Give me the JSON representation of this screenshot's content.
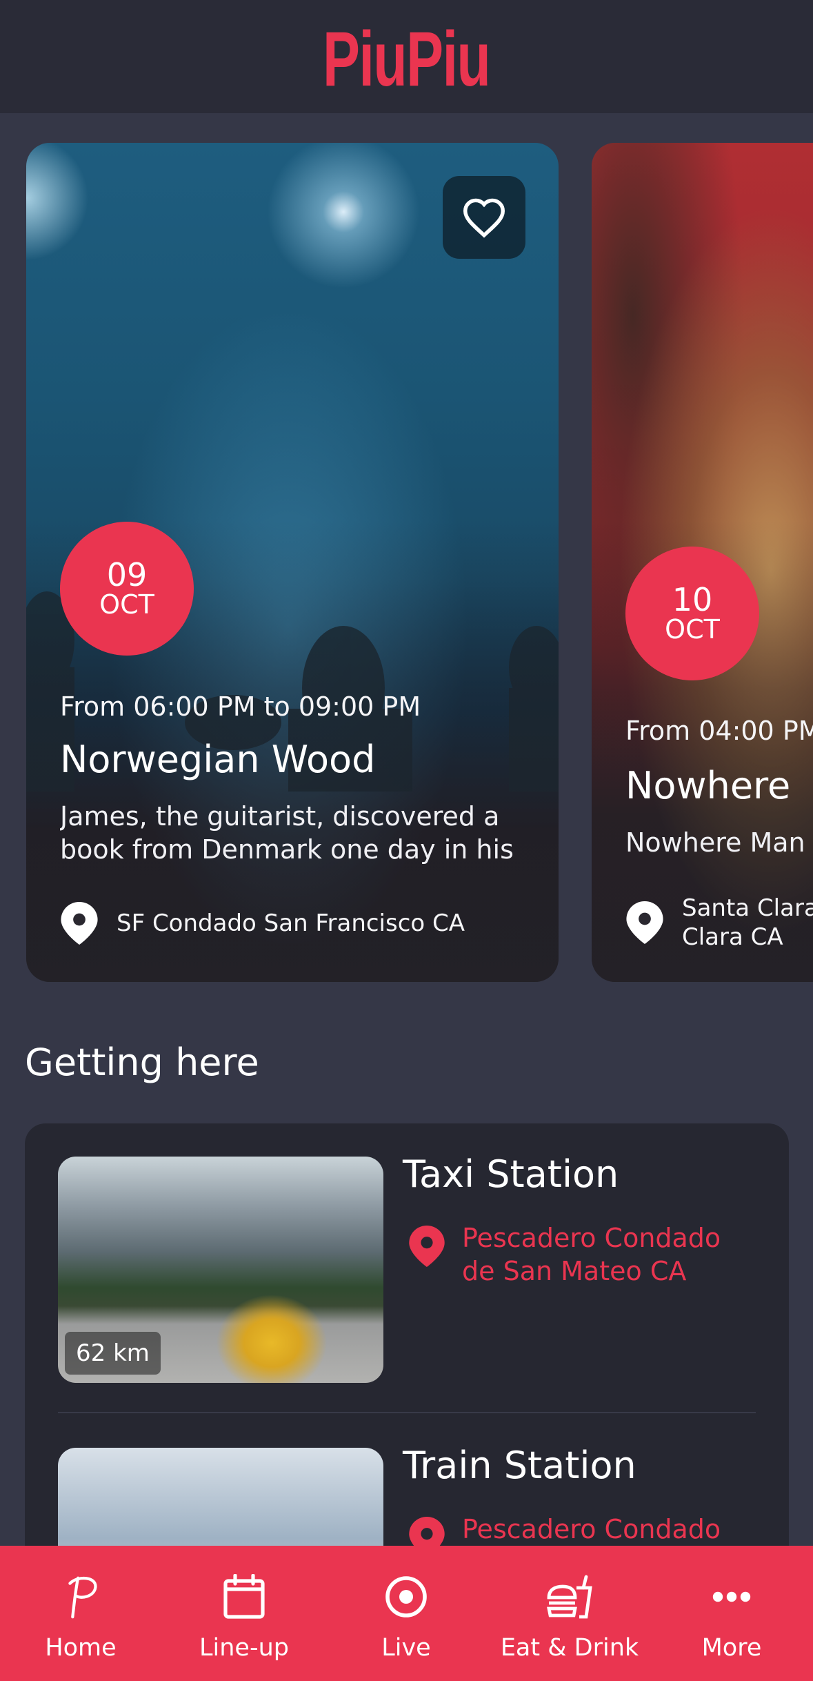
{
  "app": {
    "logo": "PiuPiu",
    "brand_color": "#ea3550",
    "background": "#353747"
  },
  "events": [
    {
      "day": "09",
      "month": "OCT",
      "time": "From 06:00 PM to 09:00 PM",
      "title": "Norwegian Wood",
      "description": "James, the guitarist, discovered a book from Denmark one day in his",
      "location": "SF Condado San Francisco CA",
      "favorite_icon": "heart-outline-icon"
    },
    {
      "day": "10",
      "month": "OCT",
      "time": "From 04:00 PM",
      "title": "Nowhere",
      "description": "Nowhere Man",
      "location": "Santa Clara\nClara CA"
    }
  ],
  "getting_here": {
    "title": "Getting here",
    "items": [
      {
        "title": "Taxi Station",
        "distance": "62 km",
        "location": "Pescadero Condado de San Mateo CA"
      },
      {
        "title": "Train Station",
        "location": "Pescadero Condado"
      }
    ]
  },
  "bottom_nav": {
    "items": [
      {
        "label": "Home",
        "icon": "piupiu-p-icon"
      },
      {
        "label": "Line-up",
        "icon": "calendar-icon"
      },
      {
        "label": "Live",
        "icon": "target-icon"
      },
      {
        "label": "Eat & Drink",
        "icon": "food-drink-icon"
      },
      {
        "label": "More",
        "icon": "more-dots-icon"
      }
    ]
  }
}
